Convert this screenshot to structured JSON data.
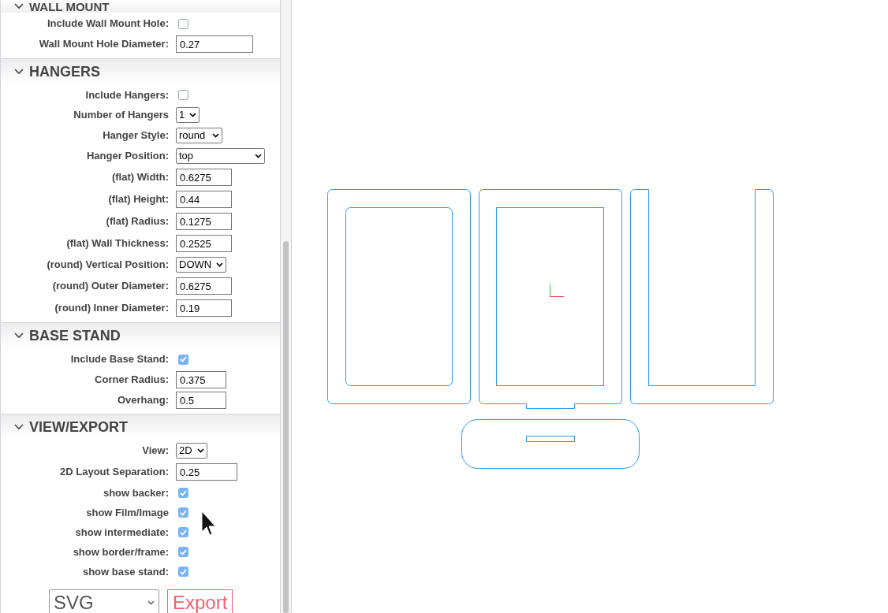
{
  "sections": [
    {
      "title": "WALL MOUNT",
      "expanded": true,
      "fields": [
        {
          "kind": "checkbox",
          "label": "Include Wall Mount Hole:",
          "checked": false
        },
        {
          "kind": "text",
          "label": "Wall Mount Hole Diameter:",
          "value": "0.27"
        }
      ]
    },
    {
      "title": "HANGERS",
      "expanded": true,
      "fields": [
        {
          "kind": "checkbox",
          "label": "Include Hangers:",
          "checked": false
        },
        {
          "kind": "select",
          "label": "Number of Hangers",
          "value": "1"
        },
        {
          "kind": "select",
          "label": "Hanger Style:",
          "value": "round"
        },
        {
          "kind": "select",
          "label": "Hanger Position:",
          "value": "top"
        },
        {
          "kind": "text",
          "label": "(flat) Width:",
          "value": "0.6275"
        },
        {
          "kind": "text",
          "label": "(flat) Height:",
          "value": "0.44"
        },
        {
          "kind": "text",
          "label": "(flat) Radius:",
          "value": "0.1275"
        },
        {
          "kind": "text",
          "label": "(flat) Wall Thickness:",
          "value": "0.2525"
        },
        {
          "kind": "select",
          "label": "(round) Vertical Position:",
          "value": "DOWN"
        },
        {
          "kind": "text",
          "label": "(round) Outer Diameter:",
          "value": "0.6275"
        },
        {
          "kind": "text",
          "label": "(round) Inner Diameter:",
          "value": "0.19"
        }
      ]
    },
    {
      "title": "BASE STAND",
      "expanded": true,
      "fields": [
        {
          "kind": "checkbox",
          "label": "Include Base Stand:",
          "checked": true
        },
        {
          "kind": "text",
          "label": "Corner Radius:",
          "value": "0.375"
        },
        {
          "kind": "text",
          "label": "Overhang:",
          "value": "0.5"
        }
      ]
    },
    {
      "title": "VIEW/EXPORT",
      "expanded": true,
      "fields": [
        {
          "kind": "select",
          "label": "View:",
          "value": "2D"
        },
        {
          "kind": "text",
          "label": "2D Layout Separation:",
          "value": "0.25"
        },
        {
          "kind": "checkbox",
          "label": "show backer:",
          "checked": true
        },
        {
          "kind": "checkbox",
          "label": "show Film/Image",
          "checked": true
        },
        {
          "kind": "checkbox",
          "label": "show intermediate:",
          "checked": true
        },
        {
          "kind": "checkbox",
          "label": "show border/frame:",
          "checked": true
        },
        {
          "kind": "checkbox",
          "label": "show base stand:",
          "checked": true
        }
      ]
    }
  ],
  "export": {
    "format": "SVG",
    "button": "Export"
  }
}
